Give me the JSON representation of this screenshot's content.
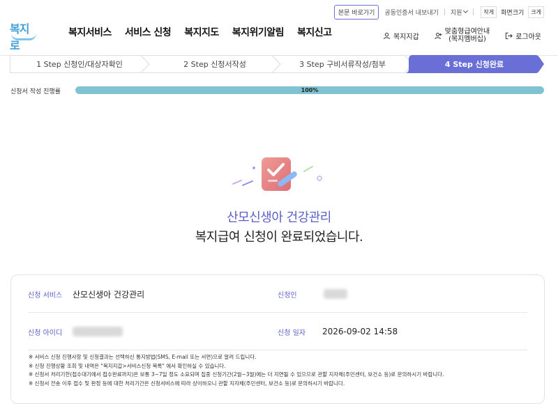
{
  "header": {
    "logo_text": "복지로",
    "nav": [
      "복지서비스",
      "서비스 신청",
      "복지지도",
      "복지위기알림",
      "복지신고"
    ],
    "utility": {
      "skip_link": "본문 바로가기",
      "cert_export": "공동인증서 내보내기",
      "support": "지원",
      "size_small": "작게",
      "size_label": "화면크기",
      "size_large": "크게"
    },
    "user_menu": {
      "wallet": "복지지갑",
      "guide_line1": "맞춤형급여안내",
      "guide_line2": "(복지멤버십)",
      "logout": "로그아웃"
    }
  },
  "steps": [
    {
      "label": "1 Step 신청인/대상자확인",
      "active": false
    },
    {
      "label": "2 Step 신청서작성",
      "active": false
    },
    {
      "label": "3 Step 구비서류작성/첨부",
      "active": false
    },
    {
      "label": "4 Step 신청완료",
      "active": true
    }
  ],
  "progress": {
    "label": "신청서 작성 진행률",
    "percent_text": "100%",
    "value": 1.0
  },
  "result": {
    "service_name": "산모신생아 건강관리",
    "message": "복지급여 신청이 완료되었습니다."
  },
  "info": {
    "service_label": "신청 서비스",
    "service_value": "산모신생아 건강관리",
    "applicant_label": "신청인",
    "id_label": "신청 아이디",
    "date_label": "신청 일자",
    "date_value": "2026-09-02 14:58"
  },
  "notes": [
    "※ 서비스 신청 진행사항 및 신청결과는 선택하신 통지방법(SMS, E-mail 또는 서면)으로 알려 드립니다.",
    "※ 신청 진행상황 조회 및 내역은 \"복지지갑>서비스신청 목록\" 에서 확인하실 수 있습니다.",
    "※ 신청서 처리기한(접수대기에서 접수완료까지)은 보통 3~7일 정도 소요되며 집중 신청기간(2월~3월)에는 더 지연될 수 있으므로 관할 지자체(주민센터, 보건소 등)로 문의하시기 바랍니다.",
    "※ 신청서 전송 이후 접수 및 판정 등에 대한 처리기간은 신청서비스에 따라 상이하오니 관할 지자체(주민센터, 보건소 등)로 문의하시기 바랍니다."
  ],
  "colors": {
    "accent": "#5a5fc8",
    "active_step": "#6a6fd8",
    "progress_fill": "#7fc3d3",
    "logo": "#3f9fd8"
  },
  "icons": {
    "wallet": "user-icon",
    "guide": "user-plus-icon",
    "logout": "logout-icon",
    "illustration": "clipboard-check-icon"
  }
}
